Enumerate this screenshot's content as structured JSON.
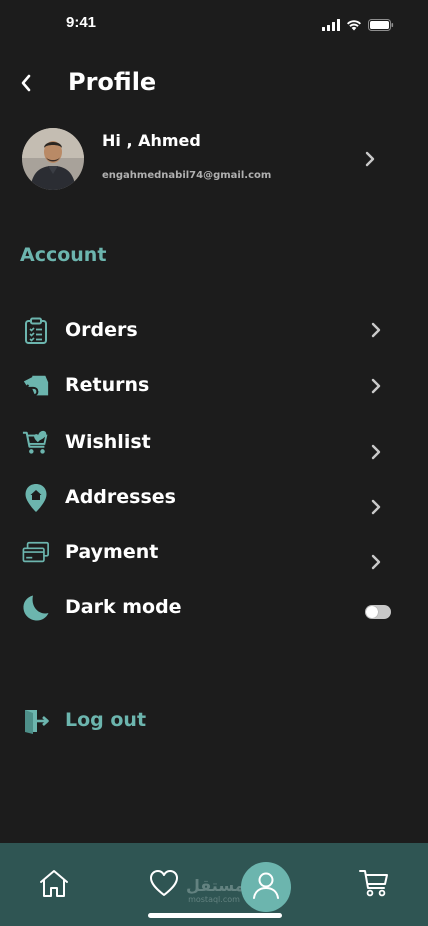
{
  "status_bar": {
    "time": "9:41"
  },
  "header": {
    "title": "Profile"
  },
  "profile": {
    "greeting": "Hi , Ahmed",
    "email": "engahmednabil74@gmail.com"
  },
  "account": {
    "section_title": "Account",
    "items": [
      {
        "label": "Orders",
        "icon": "clipboard-list-icon"
      },
      {
        "label": "Returns",
        "icon": "return-box-icon"
      },
      {
        "label": "Wishlist",
        "icon": "cart-heart-icon"
      },
      {
        "label": "Addresses",
        "icon": "location-pin-icon"
      },
      {
        "label": "Payment",
        "icon": "payment-cards-icon"
      },
      {
        "label": "Dark mode",
        "icon": "moon-icon",
        "toggle_on": false
      }
    ]
  },
  "logout": {
    "label": "Log out",
    "icon": "logout-door-icon"
  },
  "tab_bar": {
    "tabs": [
      "home-icon",
      "heart-icon",
      "profile-icon",
      "cart-icon"
    ],
    "active": "profile",
    "watermark": "مستقل",
    "watermark_sub": "mostaql.com"
  },
  "colors": {
    "background": "#1c1c1c",
    "accent": "#6cb5ae",
    "tab_bar": "#2f5553",
    "text": "#ffffff",
    "muted": "#b0b0b0"
  }
}
